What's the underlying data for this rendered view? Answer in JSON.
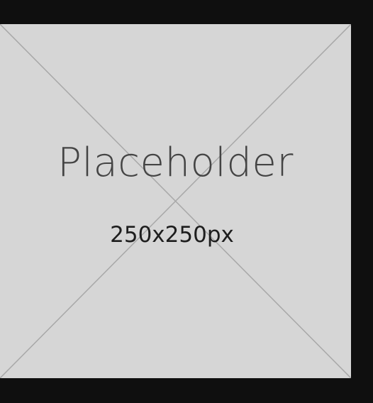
{
  "placeholder": {
    "title": "Placeholder",
    "size_label": "250x250px",
    "background_color": "#d6d6d6",
    "line_color": "#a8a8a8",
    "text_color": "#444444"
  },
  "page": {
    "background_color": "#0f0f0f"
  }
}
